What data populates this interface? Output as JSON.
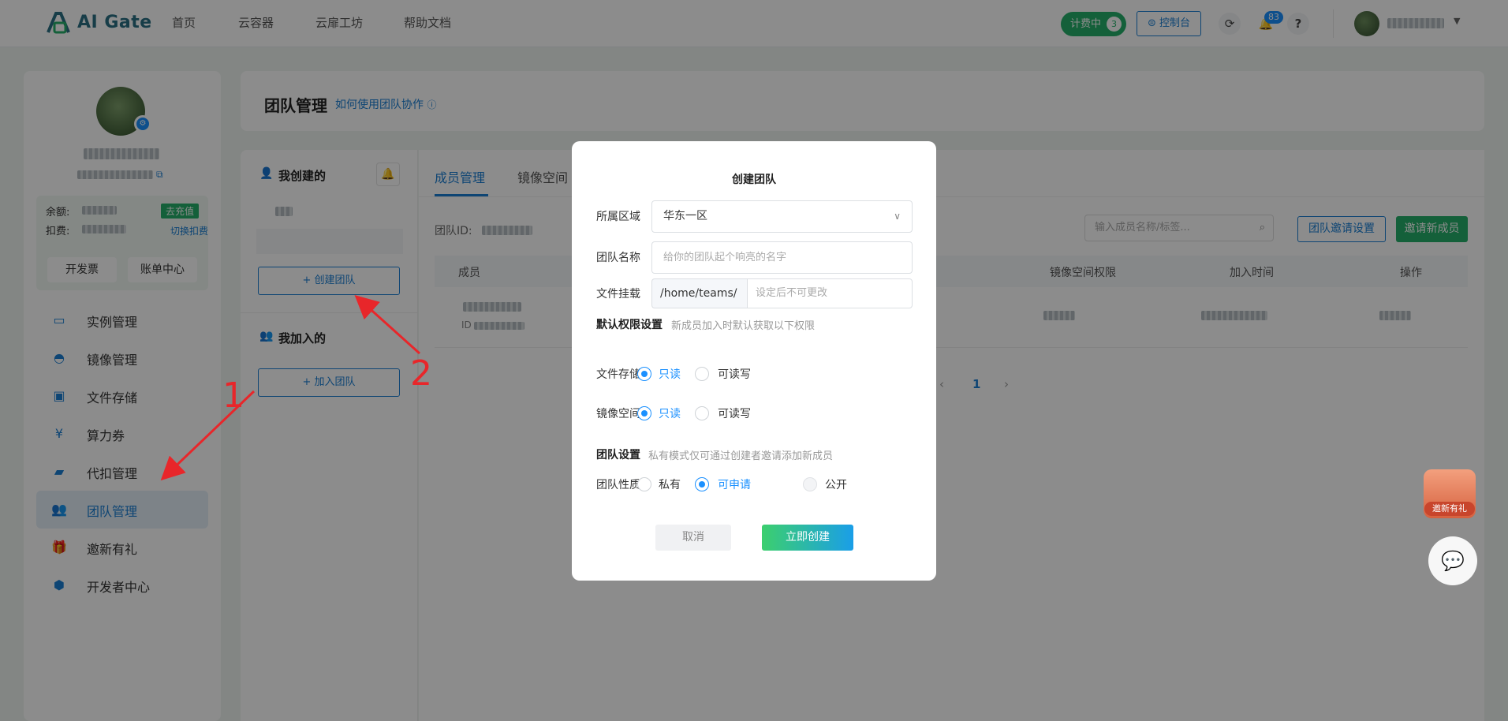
{
  "app": {
    "brand": "AI Gate"
  },
  "topnav": {
    "items": [
      "首页",
      "云容器",
      "云扉工坊",
      "帮助文档"
    ],
    "plan_label": "计费中",
    "plan_count": "3",
    "console_label": "控制台",
    "notif_count": "83",
    "help_icon": "?"
  },
  "sidebar": {
    "balance_label": "余额:",
    "deduct_label": "扣费:",
    "recharge_label": "去充值",
    "switch_label": "切换扣费",
    "invoice_label": "开发票",
    "bill_label": "账单中心",
    "menu": [
      {
        "label": "实例管理",
        "icon": "instance-icon"
      },
      {
        "label": "镜像管理",
        "icon": "image-icon"
      },
      {
        "label": "文件存储",
        "icon": "storage-icon"
      },
      {
        "label": "算力券",
        "icon": "coupon-icon"
      },
      {
        "label": "代扣管理",
        "icon": "wallet-icon"
      },
      {
        "label": "团队管理",
        "icon": "team-icon",
        "active": true
      },
      {
        "label": "邀新有礼",
        "icon": "gift-icon"
      },
      {
        "label": "开发者中心",
        "icon": "developer-icon"
      }
    ]
  },
  "page": {
    "title": "团队管理",
    "help_link": "如何使用团队协作"
  },
  "team_panel": {
    "created_title": "我创建的",
    "create_btn": "+ 创建团队",
    "joined_title": "我加入的",
    "join_btn": "+ 加入团队"
  },
  "main": {
    "tabs": [
      "成员管理",
      "镜像空间"
    ],
    "team_id_label": "团队ID:",
    "search_placeholder": "输入成员名称/标签...",
    "invite_settings_btn": "团队邀请设置",
    "invite_btn": "邀请新成员",
    "columns": [
      "成员",
      "镜像空间权限",
      "加入时间",
      "操作"
    ],
    "row_id_prefix": "ID",
    "pager_current": "1"
  },
  "floats": {
    "gift_label": "邀新有礼"
  },
  "dialog": {
    "title": "创建团队",
    "region_label": "所属区域",
    "region_value": "华东一区",
    "name_label": "团队名称",
    "name_placeholder": "给你的团队起个响亮的名字",
    "mount_label": "文件挂载",
    "mount_prefix": "/home/teams/",
    "mount_placeholder": "设定后不可更改",
    "perm_title": "默认权限设置",
    "perm_hint": "新成员加入时默认获取以下权限",
    "storage_label": "文件存储",
    "image_label": "镜像空间",
    "readonly": "只读",
    "readwrite": "可读写",
    "team_title": "团队设置",
    "team_hint": "私有模式仅可通过创建者邀请添加新成员",
    "nature_label": "团队性质",
    "private": "私有",
    "applicable": "可申请",
    "public": "公开",
    "cancel": "取消",
    "create": "立即创建"
  },
  "annotations": [
    "1",
    "2"
  ],
  "colors": {
    "accent": "#1a7fd4",
    "green": "#26b06a",
    "annotation": "#e8262a"
  }
}
